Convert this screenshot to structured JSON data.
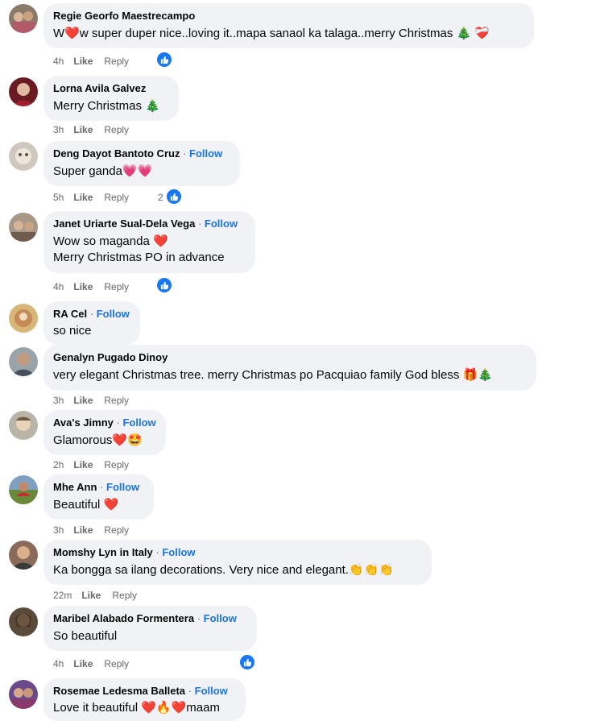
{
  "comments": [
    {
      "name": "Regie Georfo Maestrecampo",
      "follow": "",
      "lines": [
        "W❤️w super duper nice..loving it..mapa sanaol ka talaga..merry Christmas 🎄 ❤️‍🩹"
      ],
      "time": "4h",
      "like": "Like",
      "reply": "Reply",
      "reactions": ""
    },
    {
      "name": "Lorna Avila Galvez",
      "follow": "",
      "lines": [
        "Merry Christmas 🎄"
      ],
      "time": "3h",
      "like": "Like",
      "reply": "Reply",
      "reactions": ""
    },
    {
      "name": "Deng Dayot Bantoto Cruz",
      "follow": "Follow",
      "lines": [
        "Super ganda💗💗"
      ],
      "time": "5h",
      "like": "Like",
      "reply": "Reply",
      "reactions": "2"
    },
    {
      "name": "Janet Uriarte Sual-Dela Vega",
      "follow": "Follow",
      "lines": [
        "Wow so maganda ❤️",
        "Merry Christmas PO in advance"
      ],
      "time": "4h",
      "like": "Like",
      "reply": "Reply",
      "reactions": ""
    },
    {
      "name": "RA Cel",
      "follow": "Follow",
      "lines": [
        "so nice"
      ],
      "time": "",
      "like": "",
      "reply": "",
      "reactions": ""
    },
    {
      "name": "Genalyn Pugado Dinoy",
      "follow": "",
      "lines": [
        "very elegant Christmas tree. merry Christmas po Pacquiao family God bless 🎁🎄"
      ],
      "time": "3h",
      "like": "Like",
      "reply": "Reply",
      "reactions": ""
    },
    {
      "name": "Ava's Jimny",
      "follow": "Follow",
      "lines": [
        "Glamorous❤️🤩"
      ],
      "time": "2h",
      "like": "Like",
      "reply": "Reply",
      "reactions": ""
    },
    {
      "name": "Mhe Ann",
      "follow": "Follow",
      "lines": [
        "Beautiful ❤️"
      ],
      "time": "3h",
      "like": "Like",
      "reply": "Reply",
      "reactions": ""
    },
    {
      "name": "Momshy Lyn in Italy",
      "follow": "Follow",
      "lines": [
        "Ka bongga sa ilang decorations. Very nice and elegant.👏👏👏"
      ],
      "time": "22m",
      "like": "Like",
      "reply": "Reply",
      "reactions": ""
    },
    {
      "name": "Maribel Alabado Formentera",
      "follow": "Follow",
      "lines": [
        "So beautiful"
      ],
      "time": "4h",
      "like": "Like",
      "reply": "Reply",
      "reactions": ""
    },
    {
      "name": "Rosemae Ledesma Balleta",
      "follow": "Follow",
      "lines": [
        "Love it beautiful ❤️🔥❤️maam"
      ],
      "time": "",
      "like": "",
      "reply": "",
      "reactions": ""
    }
  ],
  "colors": {
    "bubble": "#f0f2f5",
    "follow": "#1b74e4",
    "meta": "#65676b",
    "like_badge": "#1877f2"
  }
}
